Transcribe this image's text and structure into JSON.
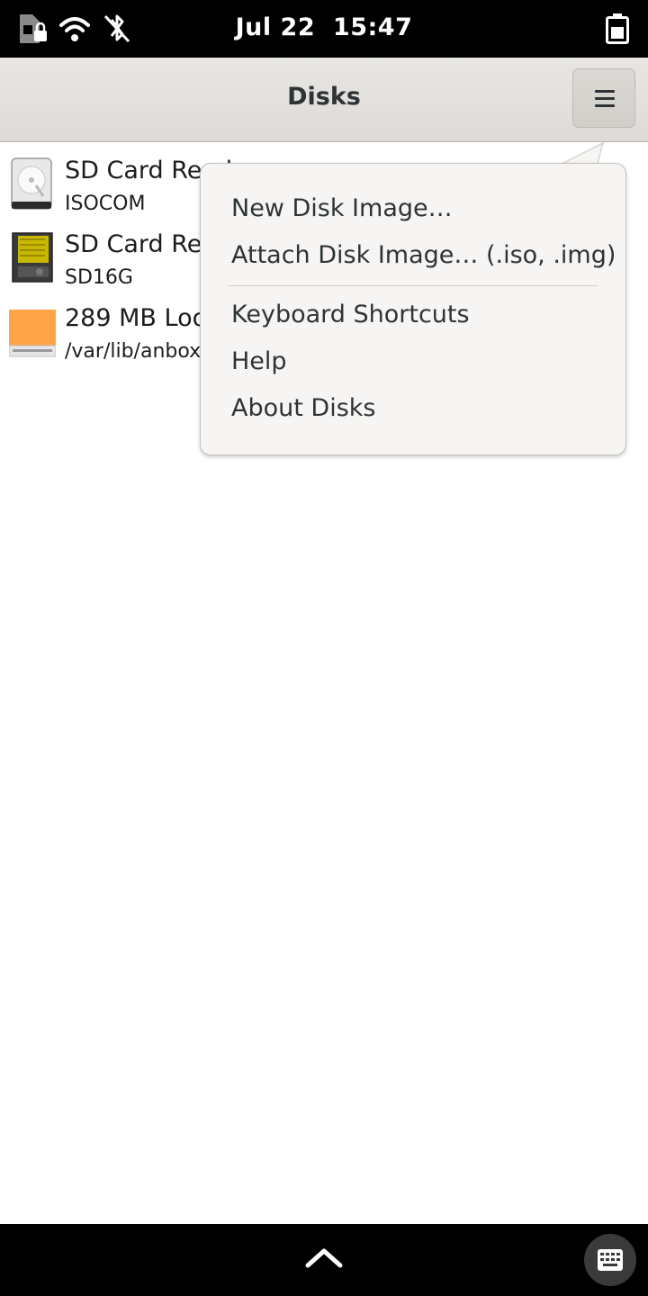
{
  "status_bar": {
    "date": "Jul 22",
    "time": "15:47",
    "icons": [
      "sim-locked-icon",
      "wifi-icon",
      "bluetooth-disabled-icon",
      "battery-icon"
    ]
  },
  "header": {
    "title": "Disks",
    "menu_icon": "hamburger-menu-icon"
  },
  "disks": [
    {
      "name": "SD Card Reader",
      "subtitle": "ISOCOM",
      "icon": "hard-disk-icon"
    },
    {
      "name": "SD Card Reader",
      "subtitle": "SD16G",
      "icon": "sd-card-icon"
    },
    {
      "name": "289 MB Loop Device",
      "subtitle": "/var/lib/anbox",
      "icon": "loop-device-icon"
    }
  ],
  "menu": {
    "items": [
      {
        "label": "New Disk Image…"
      },
      {
        "label": "Attach Disk Image… (.iso, .img)"
      },
      {
        "label": "Keyboard Shortcuts"
      },
      {
        "label": "Help"
      },
      {
        "label": "About Disks"
      }
    ]
  },
  "bottom_bar": {
    "icons": [
      "chevron-up-icon",
      "keyboard-icon"
    ]
  },
  "colors": {
    "loop_device_orange": "#ffa348",
    "popover_bg": "#f6f5f4",
    "header_bg": "#e3e0dc"
  }
}
